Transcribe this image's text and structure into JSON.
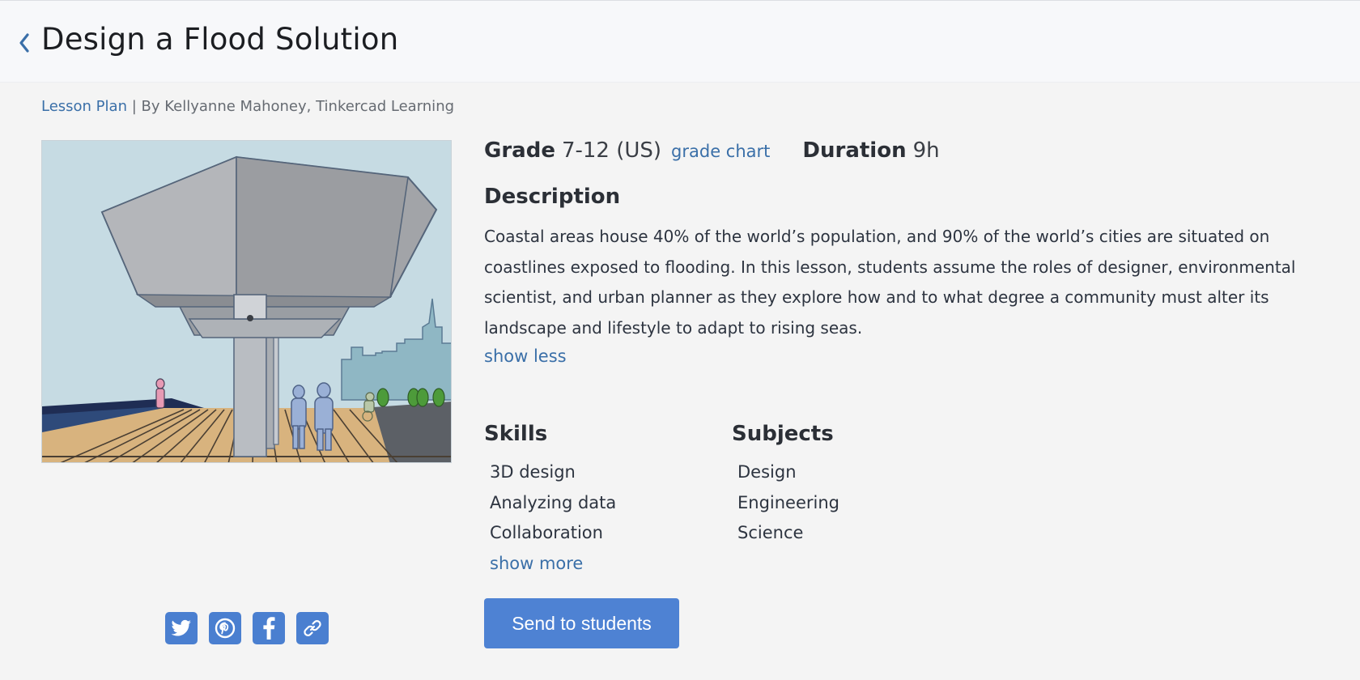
{
  "header": {
    "back_icon": "chevron-left-icon",
    "title": "Design a Flood Solution"
  },
  "byline": {
    "type_label": "Lesson Plan",
    "separator": "|",
    "author": "By Kellyanne Mahoney, Tinkercad Learning"
  },
  "hero_image": {
    "description_icon": "flood-solution-illustration"
  },
  "meta": {
    "grade_label": "Grade",
    "grade_value": "7-12 (US)",
    "grade_chart_link": "grade chart",
    "duration_label": "Duration",
    "duration_value": "9h"
  },
  "description": {
    "heading": "Description",
    "text": "Coastal areas house 40% of the world’s population, and 90% of the world’s cities are situated on coastlines exposed to flooding. In this lesson, students assume the roles of designer, environmental scientist, and urban planner as they explore how and to what degree a community must alter its landscape and lifestyle to adapt to rising seas.",
    "toggle": "show less"
  },
  "skills": {
    "heading": "Skills",
    "items": [
      "3D design",
      "Analyzing data",
      "Collaboration"
    ],
    "toggle": "show more"
  },
  "subjects": {
    "heading": "Subjects",
    "items": [
      "Design",
      "Engineering",
      "Science"
    ]
  },
  "actions": {
    "send_label": "Send to students"
  },
  "share": {
    "icons": [
      "twitter-icon",
      "pinterest-icon",
      "facebook-icon",
      "link-icon"
    ]
  },
  "colors": {
    "accent": "#4e82d3",
    "link": "#3a6fa8",
    "background": "#f4f4f4",
    "header_bg": "#f7f8fa"
  }
}
